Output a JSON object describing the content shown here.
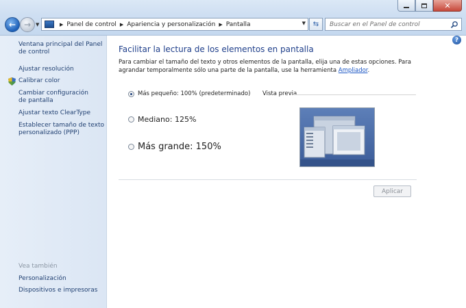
{
  "address_bar": {
    "crumbs": [
      "Panel de control",
      "Apariencia y personalización",
      "Pantalla"
    ]
  },
  "search": {
    "placeholder": "Buscar en el Panel de control"
  },
  "sidebar": {
    "items": [
      {
        "label": "Ventana principal del Panel de control"
      },
      {
        "label": "Ajustar resolución"
      },
      {
        "label": "Calibrar color"
      },
      {
        "label": "Cambiar configuración de pantalla"
      },
      {
        "label": "Ajustar texto ClearType"
      },
      {
        "label": "Establecer tamaño de texto personalizado (PPP)"
      }
    ],
    "see_also_label": "Vea también",
    "see_also": [
      {
        "label": "Personalización"
      },
      {
        "label": "Dispositivos e impresoras"
      }
    ]
  },
  "main": {
    "title": "Facilitar la lectura de los elementos en pantalla",
    "description": "Para cambiar el tamaño del texto y otros elementos de la pantalla, elija una de estas opciones. Para agrandar temporalmente sólo una parte de la pantalla, use la herramienta",
    "description_link": "Ampliador",
    "description_end": ".",
    "options": [
      {
        "label": "Más pequeño: 100% (predeterminado)",
        "checked": true
      },
      {
        "label": "Mediano: 125%",
        "checked": false
      },
      {
        "label": "Más grande: 150%",
        "checked": false
      }
    ],
    "preview_label": "Vista previa",
    "apply_label": "Aplicar"
  },
  "colors": {
    "link": "#1e3e70",
    "heading": "#1e3e8a",
    "accent": "#1a55c4"
  }
}
